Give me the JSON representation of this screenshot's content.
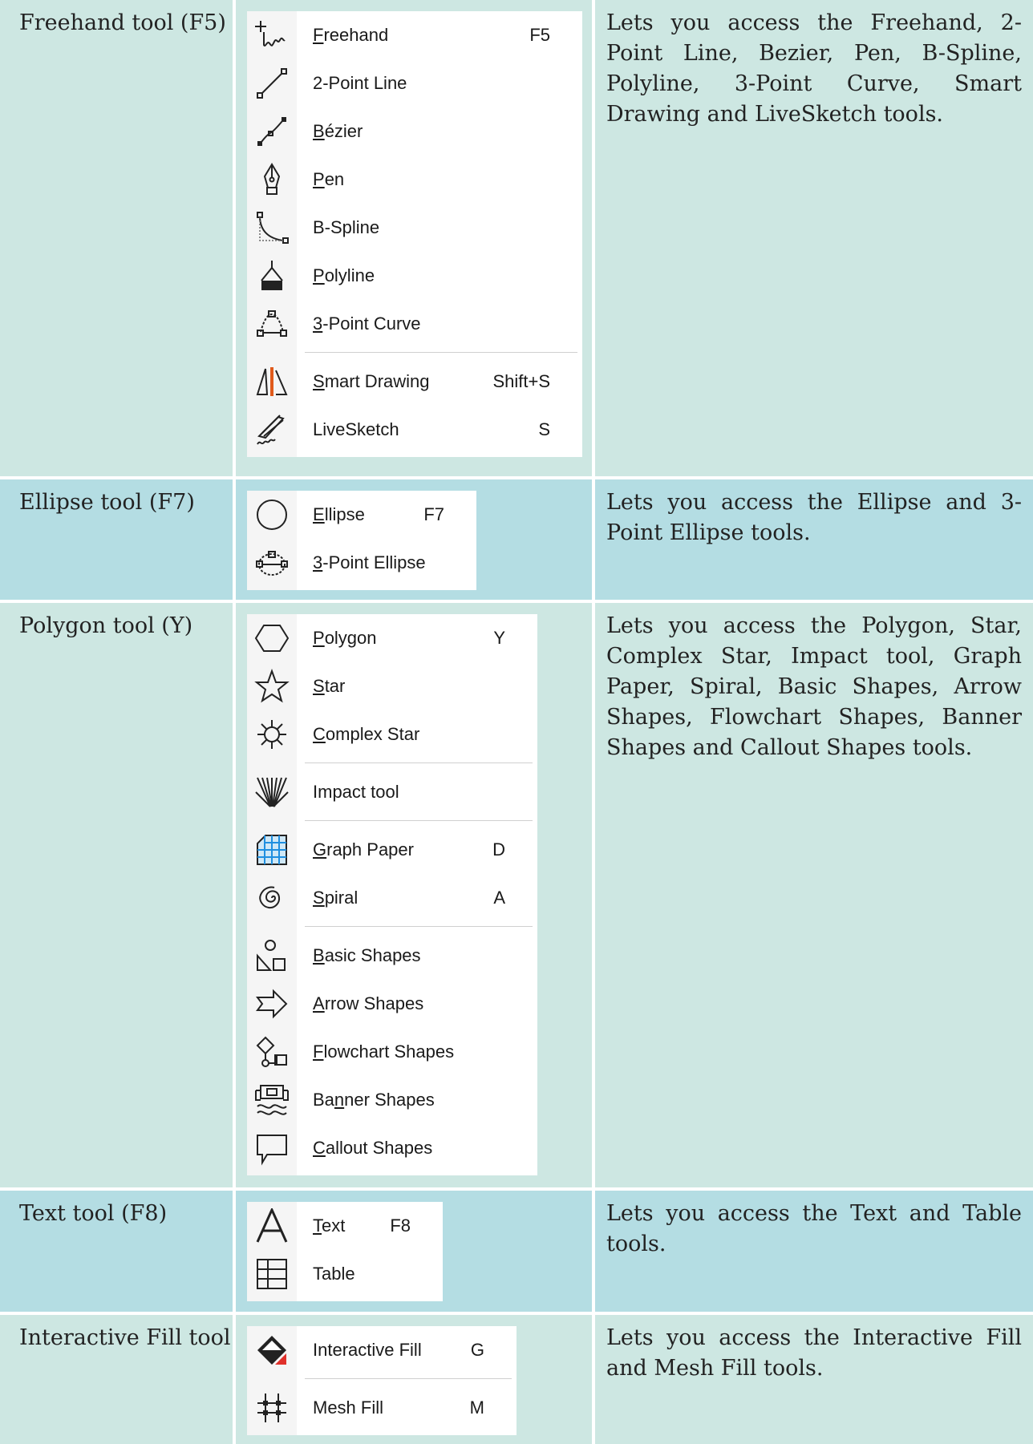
{
  "rows": [
    {
      "tool_name": "Freehand tool (F5)",
      "description": "Lets you access the Freehand, 2- Point Line, Bezier, Pen, B-Spline, Polyline, 3-Point Curve, Smart Drawing and LiveSketch tools.",
      "menu": [
        {
          "icon": "freehand-icon",
          "label": "Freehand",
          "underline_index": 0,
          "shortcut": "F5"
        },
        {
          "icon": "two-point-line-icon",
          "label": "2-Point Line",
          "underline_index": -1,
          "shortcut": ""
        },
        {
          "icon": "bezier-icon",
          "label": "Bézier",
          "underline_index": 0,
          "shortcut": ""
        },
        {
          "icon": "pen-icon",
          "label": "Pen",
          "underline_index": 0,
          "shortcut": ""
        },
        {
          "icon": "b-spline-icon",
          "label": "B-Spline",
          "underline_index": -1,
          "shortcut": ""
        },
        {
          "icon": "polyline-icon",
          "label": "Polyline",
          "underline_index": 0,
          "shortcut": ""
        },
        {
          "icon": "three-point-curve-icon",
          "label": "3-Point Curve",
          "underline_index": 0,
          "shortcut": ""
        },
        {
          "separator": true
        },
        {
          "icon": "smart-drawing-icon",
          "label": "Smart Drawing",
          "underline_index": 0,
          "shortcut": "Shift+S"
        },
        {
          "icon": "livesketch-icon",
          "label": "LiveSketch",
          "underline_index": -1,
          "shortcut": "S"
        }
      ]
    },
    {
      "tool_name": "Ellipse tool (F7)",
      "description": "Lets you access the Ellipse and 3- Point Ellipse tools.",
      "menu": [
        {
          "icon": "ellipse-icon",
          "label": "Ellipse",
          "underline_index": 0,
          "shortcut": "F7"
        },
        {
          "icon": "three-point-ellipse-icon",
          "label": "3-Point Ellipse",
          "underline_index": 0,
          "shortcut": ""
        }
      ]
    },
    {
      "tool_name": "Polygon tool (Y)",
      "description": "Lets you access the Polygon, Star, Complex Star, Impact tool, Graph Paper, Spiral, Basic Shapes, Arrow Shapes, Flowchart Shapes, Banner Shapes and Callout Shapes tools.",
      "menu": [
        {
          "icon": "polygon-icon",
          "label": "Polygon",
          "underline_index": 0,
          "shortcut": "Y"
        },
        {
          "icon": "star-icon",
          "label": "Star",
          "underline_index": 0,
          "shortcut": ""
        },
        {
          "icon": "complex-star-icon",
          "label": "Complex Star",
          "underline_index": 0,
          "shortcut": ""
        },
        {
          "separator": true
        },
        {
          "icon": "impact-tool-icon",
          "label": "Impact tool",
          "underline_index": -1,
          "shortcut": ""
        },
        {
          "separator": true
        },
        {
          "icon": "graph-paper-icon",
          "label": "Graph Paper",
          "underline_index": 0,
          "shortcut": "D"
        },
        {
          "icon": "spiral-icon",
          "label": "Spiral",
          "underline_index": 0,
          "shortcut": "A"
        },
        {
          "separator": true
        },
        {
          "icon": "basic-shapes-icon",
          "label": "Basic Shapes",
          "underline_index": 0,
          "shortcut": ""
        },
        {
          "icon": "arrow-shapes-icon",
          "label": "Arrow Shapes",
          "underline_index": 0,
          "shortcut": ""
        },
        {
          "icon": "flowchart-shapes-icon",
          "label": "Flowchart Shapes",
          "underline_index": 0,
          "shortcut": ""
        },
        {
          "icon": "banner-shapes-icon",
          "label": "Banner Shapes",
          "underline_index": 2,
          "shortcut": ""
        },
        {
          "icon": "callout-shapes-icon",
          "label": "Callout Shapes",
          "underline_index": 0,
          "shortcut": ""
        }
      ]
    },
    {
      "tool_name": "Text tool (F8)",
      "description": "Lets you access the Text and Table tools.",
      "menu": [
        {
          "icon": "text-icon",
          "label": "Text",
          "underline_index": 0,
          "shortcut": "F8"
        },
        {
          "icon": "table-icon",
          "label": "Table",
          "underline_index": -1,
          "shortcut": ""
        }
      ]
    },
    {
      "tool_name": "Interactive Fill tool",
      "description": "Lets you access the Interactive Fill and Mesh Fill tools.",
      "menu": [
        {
          "icon": "interactive-fill-icon",
          "label": "Interactive Fill",
          "underline_index": -1,
          "shortcut": "G"
        },
        {
          "separator": true
        },
        {
          "icon": "mesh-fill-icon",
          "label": "Mesh Fill",
          "underline_index": -1,
          "shortcut": "M"
        }
      ]
    }
  ]
}
